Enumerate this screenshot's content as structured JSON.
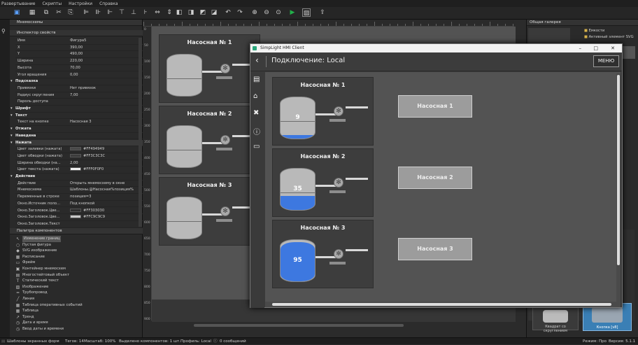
{
  "menu": [
    "Развертывание",
    "Скрипты",
    "Настройки",
    "Справка"
  ],
  "left_tabs": {
    "mnemo": "Мнемосхемы",
    "inspector": "Инспектор свойств",
    "palette": "Палитра компонентов"
  },
  "props": [
    {
      "k": "Имя",
      "v": "Фигура5"
    },
    {
      "k": "X",
      "v": "390,00"
    },
    {
      "k": "Y",
      "v": "490,00"
    },
    {
      "k": "Ширина",
      "v": "220,00"
    },
    {
      "k": "Высота",
      "v": "70,00"
    },
    {
      "k": "Угол вращения",
      "v": "0,00"
    },
    {
      "k": "Подсказка",
      "v": "",
      "sec": true
    },
    {
      "k": "Привязки",
      "v": "Нет привязок"
    },
    {
      "k": "Радиус скругления",
      "v": "7,00"
    },
    {
      "k": "Пароль доступа",
      "v": ""
    },
    {
      "k": "Шрифт",
      "v": "",
      "sec": true
    },
    {
      "k": "Текст",
      "v": "",
      "sec": true
    },
    {
      "k": "Текст на кнопке",
      "v": "Насосная 3"
    },
    {
      "k": "Отжата",
      "v": "",
      "sec": true
    },
    {
      "k": "Наведена",
      "v": "",
      "sec": true
    },
    {
      "k": "Нажата",
      "v": "",
      "sec": true
    },
    {
      "k": "Цвет заливки (нажата)",
      "v": "#FF494949",
      "sw": "#494949"
    },
    {
      "k": "Цвет обводки (нажата)",
      "v": "#FF3C3C3C",
      "sw": "#3c3c3c"
    },
    {
      "k": "Ширина обводки (на...",
      "v": "2,00"
    },
    {
      "k": "Цвет текста (нажата)",
      "v": "#FFF0F0F0",
      "sw": "#f0f0f0"
    },
    {
      "k": "Действие",
      "v": "",
      "sec": true
    },
    {
      "k": "Действие",
      "v": "Открыть мнемосхему в окне"
    },
    {
      "k": "Мнемосхема",
      "v": "Шаблоны.@Насосная%позиция%"
    },
    {
      "k": "Переменные в строке",
      "v": "позиция=3"
    },
    {
      "k": "Окно.Источник поло...",
      "v": "Под кнопкой"
    },
    {
      "k": "Окно.Заголовок.Цве...",
      "v": "#FF303030",
      "sw": "#303030"
    },
    {
      "k": "Окно.Заголовок.Цве...",
      "v": "#FFC9C9C9",
      "sw": "#c9c9c9"
    },
    {
      "k": "Окно.Заголовок.Текст",
      "v": ""
    }
  ],
  "components": [
    {
      "label": "Изменение границ",
      "icon": "↖"
    },
    {
      "label": "Пустая фигура",
      "icon": "○"
    },
    {
      "label": "SVG изображение",
      "icon": "◆"
    },
    {
      "label": "Расписание",
      "icon": "▦"
    },
    {
      "label": "Фрейм",
      "icon": "▭"
    },
    {
      "label": "Контейнер мнемосхем",
      "icon": "▣"
    },
    {
      "label": "Многостейтовый объект",
      "icon": "▤"
    },
    {
      "label": "Статический текст",
      "icon": "T"
    },
    {
      "label": "Изображение",
      "icon": "▨"
    },
    {
      "label": "Трубопровод",
      "icon": "═"
    },
    {
      "label": "Линия",
      "icon": "╱"
    },
    {
      "label": "Таблица оперативных событий",
      "icon": "▦"
    },
    {
      "label": "Таблица",
      "icon": "▦"
    },
    {
      "label": "Тренд",
      "icon": "↗"
    },
    {
      "label": "Дата и время",
      "icon": "◷"
    },
    {
      "label": "Ввод даты и времени",
      "icon": "◷"
    }
  ],
  "ruler_v": [
    "0",
    "50",
    "100",
    "150",
    "200",
    "250",
    "300",
    "350",
    "400",
    "450",
    "500",
    "550",
    "600",
    "650",
    "700",
    "750",
    "800",
    "850",
    "900"
  ],
  "editor_pumps": [
    {
      "title": "Насосная № 1"
    },
    {
      "title": "Насосная № 2"
    },
    {
      "title": "Насосная № 3"
    }
  ],
  "hmi": {
    "window_title": "SimpLight HMI Client",
    "connection": "Подключение: Local",
    "menu_button": "МЕНЮ",
    "back": "‹",
    "pumps": [
      {
        "title": "Насосная № 1",
        "level": "9",
        "fill_fraction": 0.09
      },
      {
        "title": "Насосная № 2",
        "level": "35",
        "fill_fraction": 0.35
      },
      {
        "title": "Насосная № 3",
        "level": "95",
        "fill_fraction": 0.95
      }
    ],
    "buttons": [
      "Насосная 1",
      "Насосная 2",
      "Насосная 3"
    ]
  },
  "gallery": {
    "title": "Общая галерея",
    "tree": [
      "Емкости",
      "Активный элемент SVG"
    ],
    "thumbs": [
      "Квадрат со скруглением",
      "Кнопка [v8]"
    ]
  },
  "status": {
    "templates": "Шаблоны экранных форм",
    "tags": "Тегов: 14",
    "scale": "Масштаб: 100%",
    "selected": "Выделено компонентов: 1 шт.",
    "profile": "Профиль: Local",
    "messages": "0 сообщений",
    "mode": "Режим: Про",
    "version": "Версия: 5.1.1"
  },
  "colors": {
    "accent": "#3d78e0",
    "tank": "#b9b9b9",
    "panel": "#2a2a2a",
    "status_green": "#22b04a"
  }
}
